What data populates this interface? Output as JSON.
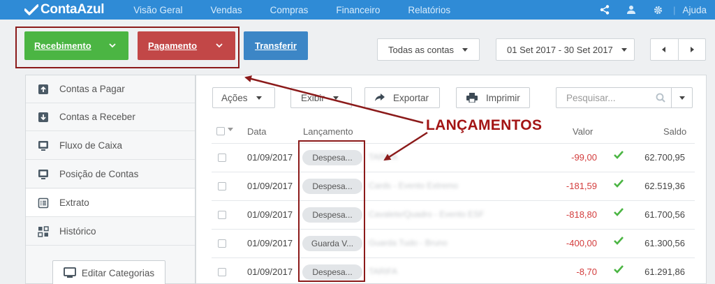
{
  "nav": {
    "logo": "ContaAzul",
    "items": [
      "Visão Geral",
      "Vendas",
      "Compras",
      "Financeiro",
      "Relatórios"
    ],
    "help": "Ajuda"
  },
  "actions": {
    "receive": "Recebimento",
    "pay": "Pagamento",
    "transfer": "Transferir",
    "account_filter": "Todas as contas",
    "date_range": "01 Set 2017 - 30 Set 2017"
  },
  "sidebar": {
    "items": [
      {
        "label": "Contas a Pagar",
        "icon": "upload-box-icon"
      },
      {
        "label": "Contas a Receber",
        "icon": "download-box-icon"
      },
      {
        "label": "Fluxo de Caixa",
        "icon": "monitor-icon"
      },
      {
        "label": "Posição de Contas",
        "icon": "monitor-icon"
      },
      {
        "label": "Extrato",
        "icon": "list-icon",
        "active": true
      },
      {
        "label": "Histórico",
        "icon": "grid-icon"
      }
    ],
    "edit_categories": "Editar Categorias"
  },
  "toolbar": {
    "actions": "Ações",
    "view": "Exibir",
    "export": "Exportar",
    "print": "Imprimir",
    "search_placeholder": "Pesquisar..."
  },
  "table": {
    "headers": {
      "date": "Data",
      "entry": "Lançamento",
      "value": "Valor",
      "balance": "Saldo"
    },
    "rows": [
      {
        "date": "01/09/2017",
        "type": "Despesa...",
        "description": "TARIFA",
        "value": "-99,00",
        "balance": "62.700,95"
      },
      {
        "date": "01/09/2017",
        "type": "Despesa...",
        "description": "Cards - Evento Extremo",
        "value": "-181,59",
        "balance": "62.519,36"
      },
      {
        "date": "01/09/2017",
        "type": "Despesa...",
        "description": "Cavalete/Quadro - Evento ESF",
        "value": "-818,80",
        "balance": "61.700,56"
      },
      {
        "date": "01/09/2017",
        "type": "Guarda V...",
        "description": "Guarda Tudo - Bruno",
        "value": "-400,00",
        "balance": "61.300,56"
      },
      {
        "date": "01/09/2017",
        "type": "Despesa...",
        "description": "TARIFA",
        "value": "-8,70",
        "balance": "61.291,86"
      }
    ]
  },
  "annotation": {
    "label": "LANÇAMENTOS"
  },
  "colors": {
    "nav": "#2f8bd6",
    "green": "#4bb543",
    "red": "#c24747",
    "blue": "#3c86c6",
    "annotation": "#a31414",
    "negative": "#d33c3c",
    "check": "#4bb543"
  }
}
